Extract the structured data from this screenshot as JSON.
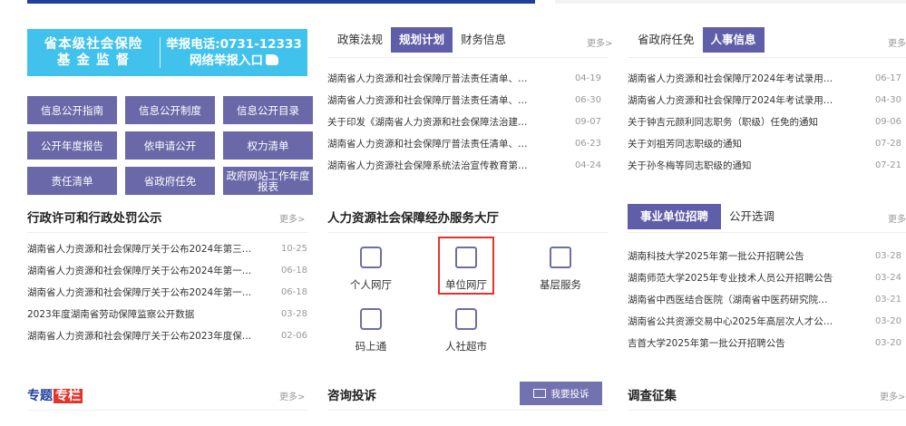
{
  "banner": {
    "left_line1": "省本级社会保险",
    "left_line2": "基 金 监 督",
    "right_line1": "举报电话:0731-12333",
    "right_line2": "网络举报入口"
  },
  "disclosure_buttons": [
    "信息公开指南",
    "信息公开制度",
    "信息公开目录",
    "公开年度报告",
    "依申请公开",
    "权力清单",
    "责任清单",
    "省政府任免",
    "政府网站工作年度报表"
  ],
  "admin_section": {
    "title": "行政许可和行政处罚公示",
    "more": "更多>",
    "items": [
      {
        "text": "湖南省人力资源和社会保障厅关于公布2024年第三…",
        "date": "10-25"
      },
      {
        "text": "湖南省人力资源和社会保障厅关于公布2024年第一…",
        "date": "06-18"
      },
      {
        "text": "湖南省人力资源和社会保障厅关于公布2024年第一…",
        "date": "06-18"
      },
      {
        "text": "2023年度湖南省劳动保障监察公开数据",
        "date": "03-28"
      },
      {
        "text": "湖南省人力资源和社会保障厅关于公布2023年度保…",
        "date": "02-06"
      }
    ]
  },
  "policy_tabs": {
    "tabs": [
      "政策法规",
      "规划计划",
      "财务信息"
    ],
    "more": "更多>",
    "items": [
      {
        "text": "湖南省人力资源和社会保障厅普法责任清单、…",
        "date": "04-19"
      },
      {
        "text": "湖南省人力资源和社会保障厅普法责任清单、…",
        "date": "06-30"
      },
      {
        "text": "关于印发《湖南省人力资源和社会保障法治建…",
        "date": "09-07"
      },
      {
        "text": "湖南省人力资源和社会保障厅普法责任清单、…",
        "date": "06-23"
      },
      {
        "text": "湖南省人力资源社会保障系统法治宣传教育第…",
        "date": "04-24"
      }
    ]
  },
  "hall": {
    "title": "人力资源社会保障经办服务大厅",
    "icons": [
      "个人网厅",
      "单位网厅",
      "基层服务",
      "码上通",
      "人社超市"
    ]
  },
  "personnel_tabs": {
    "tabs": [
      "省政府任免",
      "人事信息"
    ],
    "more": "更多",
    "items": [
      {
        "text": "湖南省人力资源和社会保障厅2024年考试录用…",
        "date": "06-17"
      },
      {
        "text": "湖南省人力资源和社会保障厅2024年考试录用…",
        "date": "04-30"
      },
      {
        "text": "关于钟吉元颜利同志职务（职级）任免的通知",
        "date": "09-06"
      },
      {
        "text": "关于刘祖芳同志职级的通知",
        "date": "07-28"
      },
      {
        "text": "关于孙冬梅等同志职级的通知",
        "date": "07-21"
      }
    ]
  },
  "recruit_tabs": {
    "tabs": [
      "事业单位招聘",
      "公开选调"
    ],
    "more": "更多",
    "items": [
      {
        "text": "湖南科技大学2025年第一批公开招聘公告",
        "date": "03-28"
      },
      {
        "text": "湖南师范大学2025年专业技术人员公开招聘公告",
        "date": "03-24"
      },
      {
        "text": "湖南省中西医结合医院（湖南省中医药研究院…",
        "date": "03-21"
      },
      {
        "text": "湖南省公共资源交易中心2025年高层次人才公…",
        "date": "03-20"
      },
      {
        "text": "吉首大学2025年第一批公开招聘公告",
        "date": "03-20"
      }
    ]
  },
  "bottom": {
    "zt_a": "专题",
    "zt_b": "专栏",
    "zt_more": "更多>",
    "consult_title": "咨询投诉",
    "complain_button": "我要投诉",
    "survey_title": "调查征集",
    "survey_more": "更多>"
  }
}
